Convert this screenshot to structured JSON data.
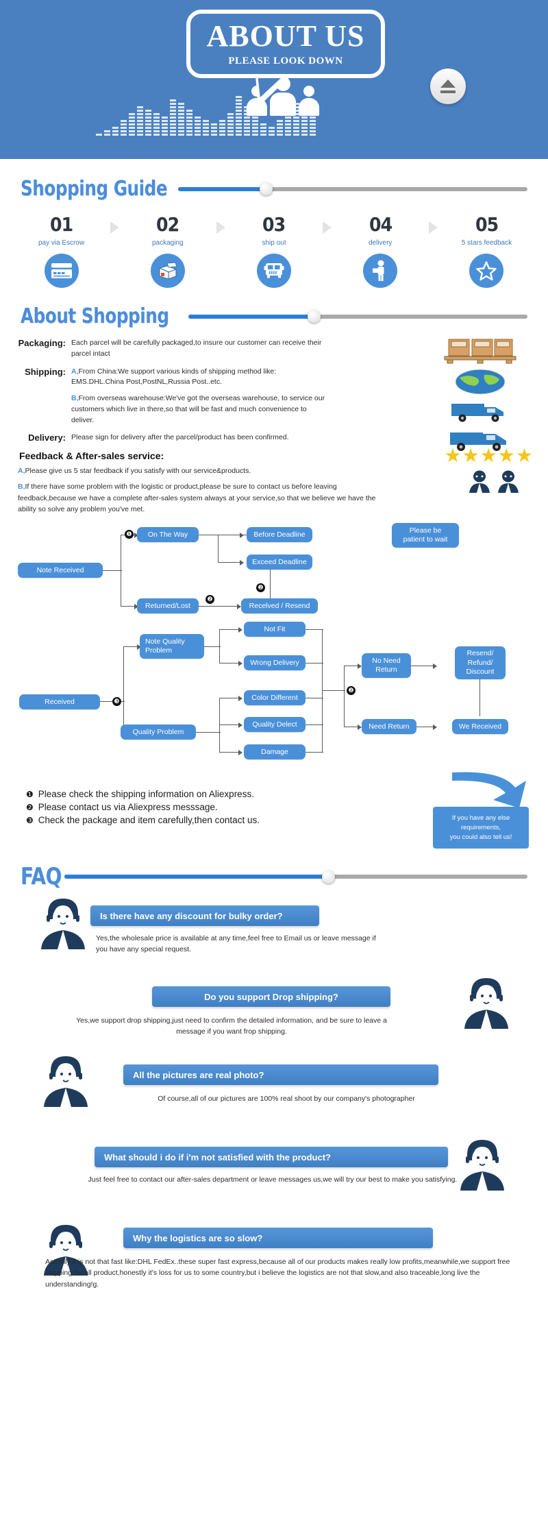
{
  "banner": {
    "title": "ABOUT US",
    "subtitle": "PLEASE LOOK DOWN",
    "eject_icon": "eject-icon",
    "equalizer_icon": "equalizer-icon",
    "people_icon": "people-group-icon"
  },
  "colors": {
    "brand_blue": "#4a90d9",
    "banner_blue": "#4a80c0",
    "title_blue": "#4a8ddb",
    "slider_fill": "#2a7fd4",
    "slider_track": "#a9a9a9",
    "star_yellow": "#f5c518",
    "flow_line": "#5a5a5a",
    "text_dark": "#1b1b1b"
  },
  "shopping_guide": {
    "title": "Shopping Guide",
    "slider_percent": 25,
    "steps": [
      {
        "num": "01",
        "label": "pay via Escrow",
        "icon": "credit-card-icon"
      },
      {
        "num": "02",
        "label": "packaging",
        "icon": "open-box-icon"
      },
      {
        "num": "03",
        "label": "ship out",
        "icon": "bus-icon"
      },
      {
        "num": "04",
        "label": "delivery",
        "icon": "delivery-person-icon"
      },
      {
        "num": "05",
        "label": "5 stars feedback",
        "icon": "star-outline-icon"
      }
    ]
  },
  "about_shopping": {
    "title": "About Shopping",
    "slider_percent": 37,
    "rows": [
      {
        "label": "Packaging:",
        "paragraphs": [
          {
            "marker": "",
            "text": "Each parcel will be carefully packaged,to insure our customer can receive their parcel intact"
          }
        ]
      },
      {
        "label": "Shipping:",
        "paragraphs": [
          {
            "marker": "A,",
            "text": "From China:We support various kinds of shipping method like: EMS.DHL.China Post,PostNL,Russia Post..etc."
          },
          {
            "marker": "B,",
            "text": "From overseas warehouse:We've got the overseas warehouse, to service our customers which live in there,so that will be fast and much convenience to deliver."
          }
        ]
      },
      {
        "label": "Delivery:",
        "paragraphs": [
          {
            "marker": "",
            "text": "Please sign for delivery after the parcel/product has been confirmed."
          }
        ]
      }
    ],
    "side_icons": [
      "boxes-pallet-icon",
      "globe-icon",
      "blue-truck-icon",
      "blue-van-icon"
    ],
    "feedback_heading": "Feedback & After-sales service:",
    "feedback_paragraphs": [
      {
        "marker": "A,",
        "text": "Please give us 5 star feedback if you satisfy with our service&products."
      },
      {
        "marker": "B,",
        "text": "If there have some problem with the logistic or product,please be sure to contact us before leaving feedback,because we have a complete after-sales system always at your service,so that we believe we have the ability so solve any problem you've met."
      }
    ],
    "stars_count": 5,
    "star_glyph": "★",
    "agents_icon": "support-agents-icon"
  },
  "flow_one": {
    "nodes": [
      {
        "id": "note_received",
        "label": "Note Received"
      },
      {
        "id": "on_the_way",
        "label": "On The Way"
      },
      {
        "id": "returned_lost",
        "label": "Returned/Lost"
      },
      {
        "id": "before_deadline",
        "label": "Before Deadline"
      },
      {
        "id": "exceed_deadline",
        "label": "Exceed Deadline"
      },
      {
        "id": "received_resend",
        "label": "Recelved / Resend"
      },
      {
        "id": "please_patient",
        "label": "Please be\npatient to wait"
      }
    ],
    "markers": [
      "❶",
      "❷",
      "❷"
    ]
  },
  "flow_two": {
    "nodes": [
      {
        "id": "received",
        "label": "Received"
      },
      {
        "id": "note_quality_problem",
        "label": "Note Quality\nProblem"
      },
      {
        "id": "quality_problem",
        "label": "Quality Problem"
      },
      {
        "id": "not_fit",
        "label": "Not Fit"
      },
      {
        "id": "wrong_delivery",
        "label": "Wrong Delivery"
      },
      {
        "id": "color_different",
        "label": "Color Different"
      },
      {
        "id": "quality_delect",
        "label": "Quality Delect"
      },
      {
        "id": "damage",
        "label": "Damage"
      },
      {
        "id": "no_need_return",
        "label": "No Need\nReturn"
      },
      {
        "id": "need_return",
        "label": "Need Return"
      },
      {
        "id": "resend_refund_discount",
        "label": "Resend/\nRefund/\nDiscount"
      },
      {
        "id": "we_received",
        "label": "We Received"
      }
    ],
    "markers": [
      "❸",
      "❷"
    ]
  },
  "notes": [
    {
      "bullet": "❶",
      "text": "Please check the shipping information on Aliexpress."
    },
    {
      "bullet": "❷",
      "text": "Please contact us via Aliexpress messsage."
    },
    {
      "bullet": "❸",
      "text": "Check the package and item carefully,then contact us."
    }
  ],
  "callout": {
    "text": "If you have any else\nrequirements,\nyou could also tell us!",
    "arrow_icon": "curved-arrow-icon"
  },
  "faq": {
    "title": "FAQ",
    "slider_percent": 57,
    "items": [
      {
        "question": "Is there have any discount for bulky order?",
        "answer": "Yes,the wholesale price is available at any time,feel free to Email us or leave message if you have any special request.",
        "avatar": "support-agent-icon",
        "avatar_side": "left",
        "align": "left"
      },
      {
        "question": "Do you support Drop shipping?",
        "answer": "Yes,we support drop shipping,just need to confirm the detailed information, and be sure to leave a message if you want frop shipping.",
        "avatar": "support-agent-icon",
        "avatar_side": "right",
        "align": "center"
      },
      {
        "question": "All the pictures are real photo?",
        "answer": "Of course,all of our pictures are 100% real shoot by our company's photographer",
        "avatar": "support-agent-icon",
        "avatar_side": "left",
        "align": "center"
      },
      {
        "question": "What should i do if i'm not satisfied with the product?",
        "answer": "Just feel free to contact our after-sales department or leave messages us,we will try our best to make you satisfying.",
        "avatar": "support-agent-icon",
        "avatar_side": "right",
        "align": "center"
      },
      {
        "question": "Why the logistics are so slow?",
        "answer": "Actually it is not that fast like:DHL FedEx..these super fast express,because all of our products makes really low profits,meanwhile,we support free shipping for all product,honestly it's loss for us to some country,but i believe the logistics are not that slow,and also traceable,long live the understanding!g.",
        "avatar": "support-agent-icon",
        "avatar_side": "left",
        "align": "center"
      }
    ]
  }
}
